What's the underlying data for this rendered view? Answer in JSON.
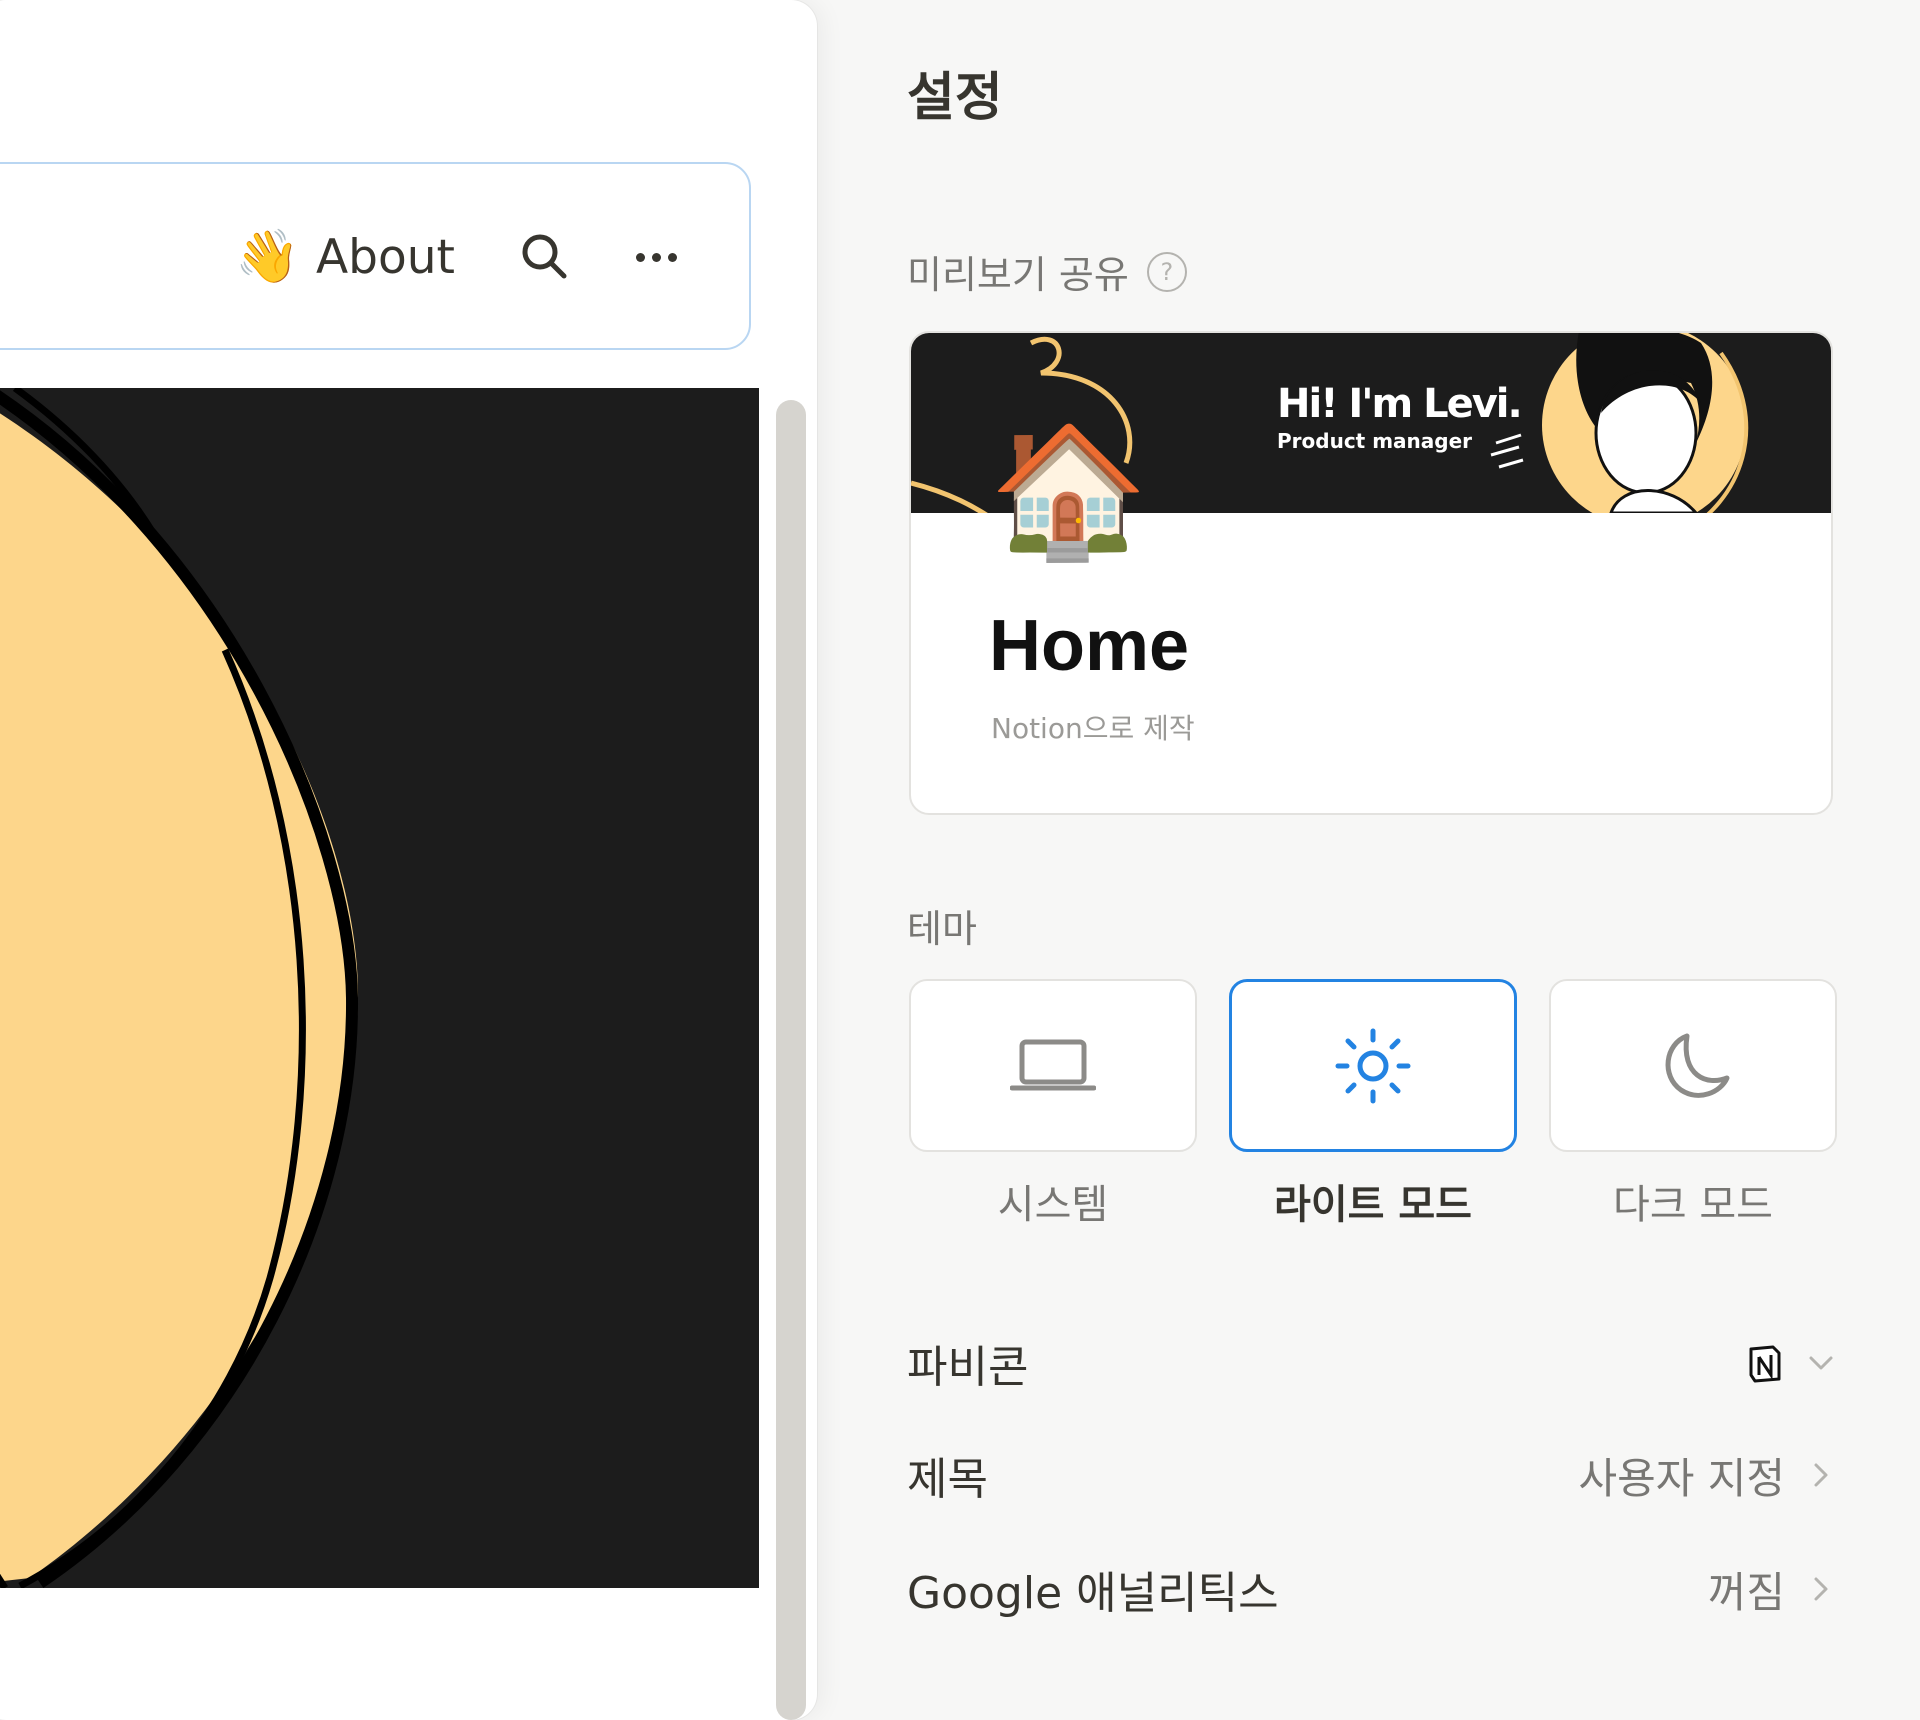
{
  "header": {
    "about_emoji": "👋",
    "about_label": "About"
  },
  "settings": {
    "title": "설정",
    "share_preview": {
      "label": "미리보기 공유",
      "help": "?",
      "cover_heading": "Hi! I'm Levi.",
      "cover_subheading": "Product manager",
      "emoji": "🏠",
      "page_title": "Home",
      "made_with": "Notion으로 제작"
    },
    "theme": {
      "label": "테마",
      "options": [
        {
          "label": "시스템",
          "icon": "laptop-icon",
          "selected": false
        },
        {
          "label": "라이트 모드",
          "icon": "sun-icon",
          "selected": true
        },
        {
          "label": "다크 모드",
          "icon": "moon-icon",
          "selected": false
        }
      ]
    },
    "rows": [
      {
        "name": "파비콘",
        "value": "",
        "value_icon": "notion-logo-icon",
        "control": "chevron-down-icon"
      },
      {
        "name": "제목",
        "value": "사용자 지정",
        "control": "chevron-right-icon"
      },
      {
        "name": "Google 애널리틱스",
        "value": "꺼짐",
        "control": "chevron-right-icon"
      }
    ]
  },
  "colors": {
    "accent": "#2383e2",
    "cover_dark": "#1c1c1c",
    "cover_peach": "#fdd68b"
  }
}
